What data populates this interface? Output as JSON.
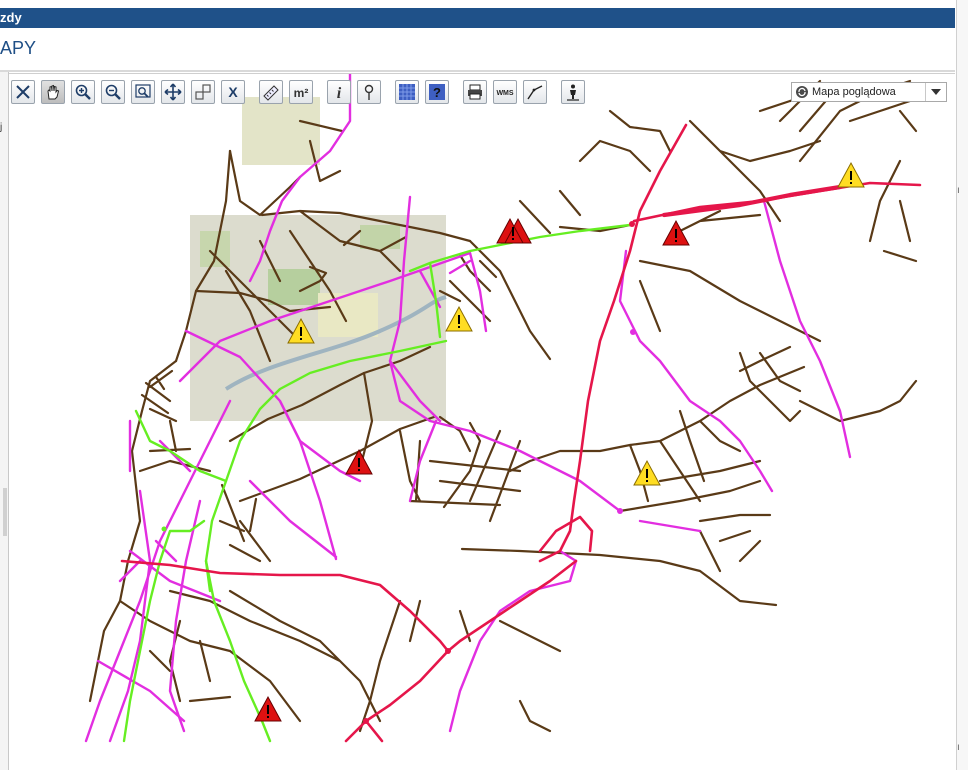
{
  "window": {
    "title": "zdy"
  },
  "page": {
    "heading": "APY"
  },
  "left_panel": {
    "fragment": "j"
  },
  "toolbar": {
    "tools": [
      {
        "name": "close-icon",
        "label": "X"
      },
      {
        "name": "hand-pan-icon"
      },
      {
        "name": "zoom-in-icon"
      },
      {
        "name": "zoom-out-icon"
      },
      {
        "name": "zoom-window-icon"
      },
      {
        "name": "move-icon"
      },
      {
        "name": "full-extent-icon"
      },
      {
        "name": "clear-icon",
        "label": "X"
      },
      {
        "name": "ruler-icon"
      },
      {
        "name": "area-measure-icon",
        "label": "m²"
      },
      {
        "name": "info-icon",
        "label": "i"
      },
      {
        "name": "pin-icon"
      },
      {
        "name": "layers-icon"
      },
      {
        "name": "help-icon",
        "label": "?"
      },
      {
        "name": "print-icon"
      },
      {
        "name": "wms-icon",
        "label": "WMS"
      },
      {
        "name": "profile-icon"
      },
      {
        "name": "person-icon"
      }
    ]
  },
  "layer_select": {
    "value": "Mapa poglądowa"
  },
  "colors": {
    "header_blue": "#1f5189",
    "road_local": "#5a3a17",
    "road_district": "#e22ee0",
    "road_county": "#66ee22",
    "road_national": "#e5164a",
    "warning_red": "#dd1111",
    "warning_yellow": "#ffdd22"
  },
  "warnings": [
    {
      "type": "red"
    },
    {
      "type": "red"
    },
    {
      "type": "red"
    },
    {
      "type": "red"
    },
    {
      "type": "yellow"
    },
    {
      "type": "yellow"
    },
    {
      "type": "yellow"
    },
    {
      "type": "yellow"
    }
  ]
}
